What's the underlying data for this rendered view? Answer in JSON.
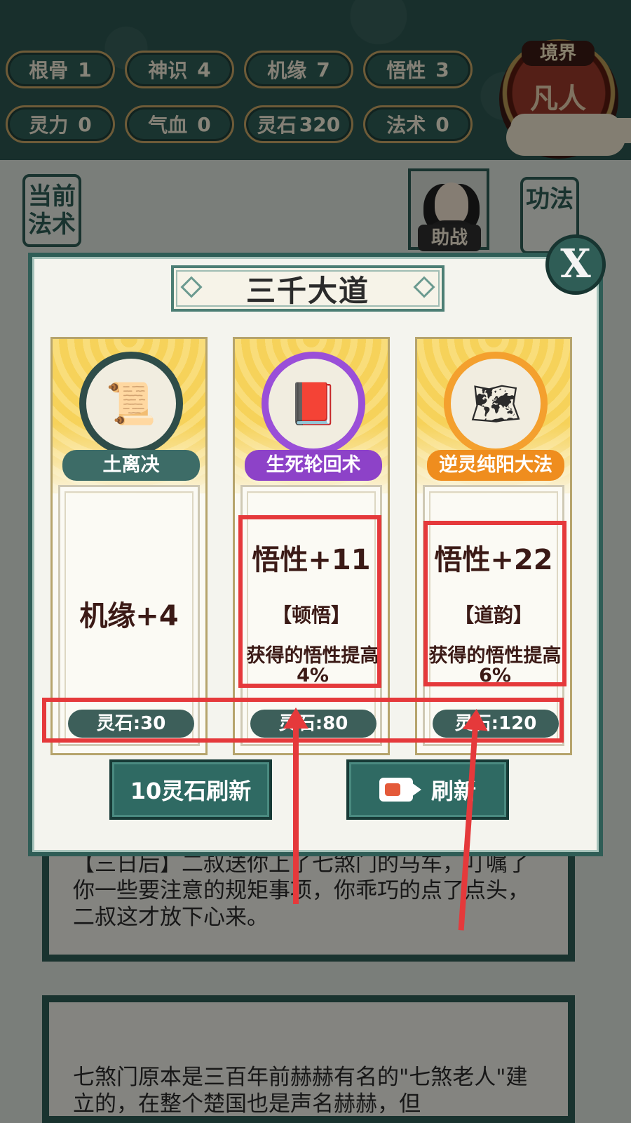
{
  "stats": [
    {
      "label": "根骨",
      "value": "1"
    },
    {
      "label": "神识",
      "value": "4"
    },
    {
      "label": "机缘",
      "value": "7"
    },
    {
      "label": "悟性",
      "value": "3"
    },
    {
      "label": "灵力",
      "value": "0"
    },
    {
      "label": "气血",
      "value": "0"
    },
    {
      "label": "灵石",
      "value": "320"
    },
    {
      "label": "法术",
      "value": "0"
    }
  ],
  "realm": {
    "tag": "境界",
    "name": "凡人"
  },
  "side": {
    "current_spell": "当前法术",
    "gongfa": "功法",
    "assist": "助战"
  },
  "story": {
    "p1": "【三日后】二叔送你上了七煞门的马车，叮嘱了你一些要注意的规矩事项，你乖巧的点了点头，二叔这才放下心来。",
    "p2": "七煞门原本是三百年前赫赫有名的\"七煞老人\"建立的，在整个楚国也是声名赫赫，但"
  },
  "modal": {
    "title": "三千大道",
    "close_label": "X",
    "cards": [
      {
        "name": "土离决",
        "icon": "scroll-icon",
        "effect": "机缘+4",
        "tag": "",
        "desc": "",
        "price": "灵石:30"
      },
      {
        "name": "生死轮回术",
        "icon": "book-icon",
        "effect": "悟性+11",
        "tag": "【顿悟】",
        "desc": "获得的悟性提高4%",
        "price": "灵石:80"
      },
      {
        "name": "逆灵纯阳大法",
        "icon": "map-scroll-icon",
        "effect": "悟性+22",
        "tag": "【道韵】",
        "desc": "获得的悟性提高6%",
        "price": "灵石:120"
      }
    ],
    "refresh_paid": "10灵石刷新",
    "refresh_video": "刷新"
  },
  "colors": {
    "accent": "#2f5d56",
    "highlight": "#e5393b",
    "gold": "#f6d25a"
  }
}
